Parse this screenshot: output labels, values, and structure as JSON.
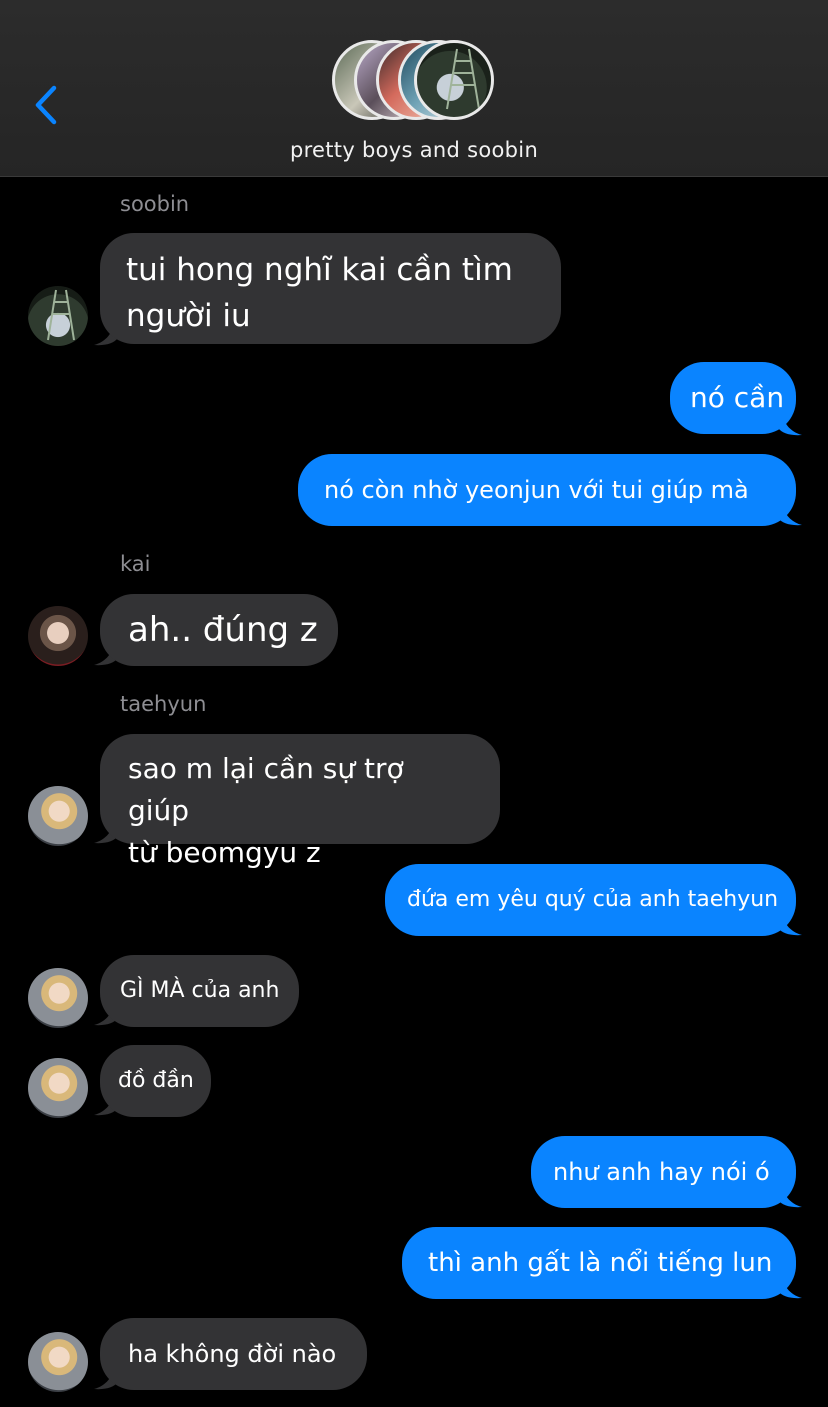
{
  "header": {
    "title": "pretty boys and soobin",
    "back_icon": "chevron-left-icon",
    "accent": "#0a84ff"
  },
  "messages": [
    {
      "sender": "soobin"
    },
    {
      "text_lines": [
        "tui hong nghĩ kai cần tìm",
        "người iu"
      ]
    },
    {
      "text": "nó cần"
    },
    {
      "text": "nó còn nhờ yeonjun với tui giúp mà"
    },
    {
      "sender": "kai"
    },
    {
      "text": "ah.. đúng z"
    },
    {
      "sender": "taehyun"
    },
    {
      "text_lines": [
        "sao m lại cần sự trợ giúp",
        "từ beomgyu z"
      ]
    },
    {
      "text": "đứa em yêu quý của anh taehyun"
    },
    {
      "text": "GÌ MÀ của anh"
    },
    {
      "text": "đồ đần"
    },
    {
      "text": "như anh hay nói ó"
    },
    {
      "text": "thì anh gất là nổi tiếng lun"
    },
    {
      "text": "ha không đời nào"
    }
  ],
  "colors": {
    "incoming_bubble": "#333335",
    "outgoing_bubble": "#0a84ff",
    "background": "#000000",
    "header_bg": "#2a2a2a",
    "sender_label": "#8e8e93"
  }
}
